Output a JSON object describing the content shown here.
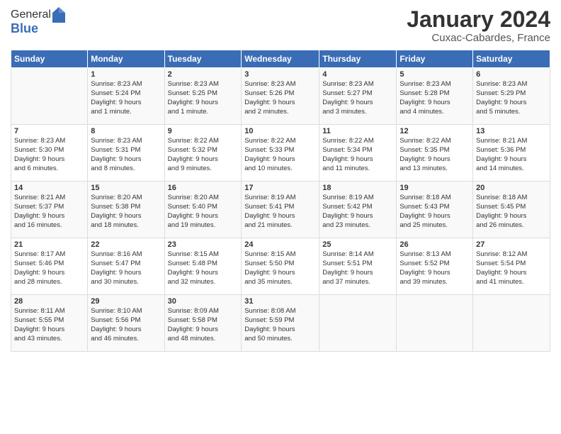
{
  "logo": {
    "general": "General",
    "blue": "Blue"
  },
  "title": "January 2024",
  "subtitle": "Cuxac-Cabardes, France",
  "days_header": [
    "Sunday",
    "Monday",
    "Tuesday",
    "Wednesday",
    "Thursday",
    "Friday",
    "Saturday"
  ],
  "weeks": [
    [
      {
        "num": "",
        "info": ""
      },
      {
        "num": "1",
        "info": "Sunrise: 8:23 AM\nSunset: 5:24 PM\nDaylight: 9 hours\nand 1 minute."
      },
      {
        "num": "2",
        "info": "Sunrise: 8:23 AM\nSunset: 5:25 PM\nDaylight: 9 hours\nand 1 minute."
      },
      {
        "num": "3",
        "info": "Sunrise: 8:23 AM\nSunset: 5:26 PM\nDaylight: 9 hours\nand 2 minutes."
      },
      {
        "num": "4",
        "info": "Sunrise: 8:23 AM\nSunset: 5:27 PM\nDaylight: 9 hours\nand 3 minutes."
      },
      {
        "num": "5",
        "info": "Sunrise: 8:23 AM\nSunset: 5:28 PM\nDaylight: 9 hours\nand 4 minutes."
      },
      {
        "num": "6",
        "info": "Sunrise: 8:23 AM\nSunset: 5:29 PM\nDaylight: 9 hours\nand 5 minutes."
      }
    ],
    [
      {
        "num": "7",
        "info": "Sunrise: 8:23 AM\nSunset: 5:30 PM\nDaylight: 9 hours\nand 6 minutes."
      },
      {
        "num": "8",
        "info": "Sunrise: 8:23 AM\nSunset: 5:31 PM\nDaylight: 9 hours\nand 8 minutes."
      },
      {
        "num": "9",
        "info": "Sunrise: 8:22 AM\nSunset: 5:32 PM\nDaylight: 9 hours\nand 9 minutes."
      },
      {
        "num": "10",
        "info": "Sunrise: 8:22 AM\nSunset: 5:33 PM\nDaylight: 9 hours\nand 10 minutes."
      },
      {
        "num": "11",
        "info": "Sunrise: 8:22 AM\nSunset: 5:34 PM\nDaylight: 9 hours\nand 11 minutes."
      },
      {
        "num": "12",
        "info": "Sunrise: 8:22 AM\nSunset: 5:35 PM\nDaylight: 9 hours\nand 13 minutes."
      },
      {
        "num": "13",
        "info": "Sunrise: 8:21 AM\nSunset: 5:36 PM\nDaylight: 9 hours\nand 14 minutes."
      }
    ],
    [
      {
        "num": "14",
        "info": "Sunrise: 8:21 AM\nSunset: 5:37 PM\nDaylight: 9 hours\nand 16 minutes."
      },
      {
        "num": "15",
        "info": "Sunrise: 8:20 AM\nSunset: 5:38 PM\nDaylight: 9 hours\nand 18 minutes."
      },
      {
        "num": "16",
        "info": "Sunrise: 8:20 AM\nSunset: 5:40 PM\nDaylight: 9 hours\nand 19 minutes."
      },
      {
        "num": "17",
        "info": "Sunrise: 8:19 AM\nSunset: 5:41 PM\nDaylight: 9 hours\nand 21 minutes."
      },
      {
        "num": "18",
        "info": "Sunrise: 8:19 AM\nSunset: 5:42 PM\nDaylight: 9 hours\nand 23 minutes."
      },
      {
        "num": "19",
        "info": "Sunrise: 8:18 AM\nSunset: 5:43 PM\nDaylight: 9 hours\nand 25 minutes."
      },
      {
        "num": "20",
        "info": "Sunrise: 8:18 AM\nSunset: 5:45 PM\nDaylight: 9 hours\nand 26 minutes."
      }
    ],
    [
      {
        "num": "21",
        "info": "Sunrise: 8:17 AM\nSunset: 5:46 PM\nDaylight: 9 hours\nand 28 minutes."
      },
      {
        "num": "22",
        "info": "Sunrise: 8:16 AM\nSunset: 5:47 PM\nDaylight: 9 hours\nand 30 minutes."
      },
      {
        "num": "23",
        "info": "Sunrise: 8:15 AM\nSunset: 5:48 PM\nDaylight: 9 hours\nand 32 minutes."
      },
      {
        "num": "24",
        "info": "Sunrise: 8:15 AM\nSunset: 5:50 PM\nDaylight: 9 hours\nand 35 minutes."
      },
      {
        "num": "25",
        "info": "Sunrise: 8:14 AM\nSunset: 5:51 PM\nDaylight: 9 hours\nand 37 minutes."
      },
      {
        "num": "26",
        "info": "Sunrise: 8:13 AM\nSunset: 5:52 PM\nDaylight: 9 hours\nand 39 minutes."
      },
      {
        "num": "27",
        "info": "Sunrise: 8:12 AM\nSunset: 5:54 PM\nDaylight: 9 hours\nand 41 minutes."
      }
    ],
    [
      {
        "num": "28",
        "info": "Sunrise: 8:11 AM\nSunset: 5:55 PM\nDaylight: 9 hours\nand 43 minutes."
      },
      {
        "num": "29",
        "info": "Sunrise: 8:10 AM\nSunset: 5:56 PM\nDaylight: 9 hours\nand 46 minutes."
      },
      {
        "num": "30",
        "info": "Sunrise: 8:09 AM\nSunset: 5:58 PM\nDaylight: 9 hours\nand 48 minutes."
      },
      {
        "num": "31",
        "info": "Sunrise: 8:08 AM\nSunset: 5:59 PM\nDaylight: 9 hours\nand 50 minutes."
      },
      {
        "num": "",
        "info": ""
      },
      {
        "num": "",
        "info": ""
      },
      {
        "num": "",
        "info": ""
      }
    ]
  ]
}
